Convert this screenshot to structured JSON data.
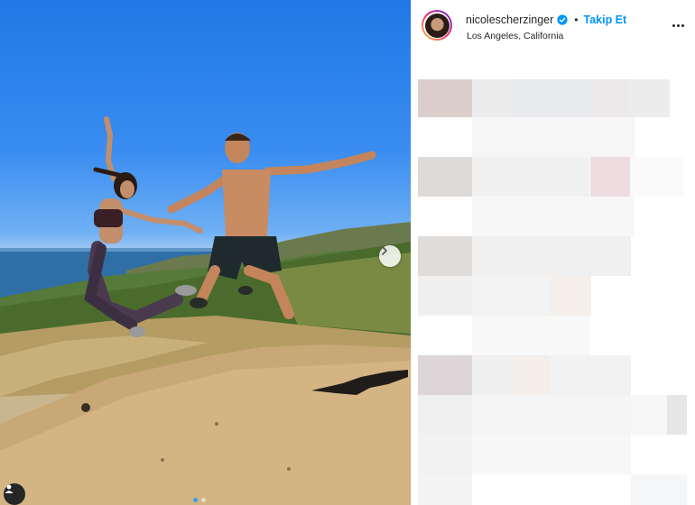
{
  "post": {
    "image_alt": "",
    "carousel_dots": 2,
    "active_dot": 0
  },
  "header": {
    "username": "nicolescherzinger",
    "verified": true,
    "separator": "•",
    "follow_label": "Takip Et",
    "location": "Los Angeles, California"
  },
  "colors": {
    "follow_blue": "#0095f6",
    "verified_blue": "#0095f6",
    "text": "#262626"
  },
  "icons": [
    "verified-badge-icon",
    "more-options-icon",
    "chevron-right-icon",
    "user-tag-icon"
  ]
}
